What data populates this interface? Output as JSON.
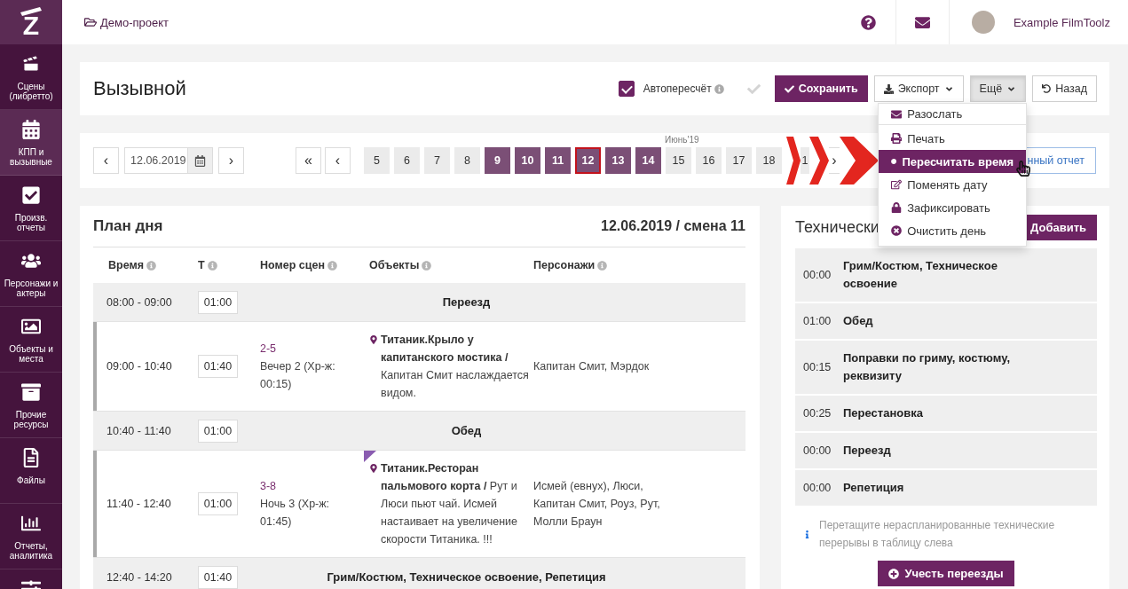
{
  "sidebar": {
    "logo": "Z",
    "items": [
      {
        "label": "Сцены (либретто)",
        "selected": false
      },
      {
        "label": "КПП и вызывные",
        "selected": true
      },
      {
        "label": "Произв. отчеты",
        "selected": false
      },
      {
        "label": "Персонажи и актеры",
        "selected": false
      },
      {
        "label": "Объекты и места",
        "selected": false
      },
      {
        "label": "Прочие ресурсы",
        "selected": false
      },
      {
        "label": "Файлы",
        "selected": false
      },
      {
        "label": "Отчеты, аналитика",
        "selected": false
      },
      {
        "selected": false
      }
    ]
  },
  "header": {
    "project": "Демо-проект",
    "user": "Example FilmToolz"
  },
  "toolbar": {
    "title": "Вызывной",
    "autorecalc": {
      "label": "Автопересчёт",
      "checked": true
    },
    "save": "Сохранить",
    "export": "Экспорт",
    "more": {
      "label": "Ещё",
      "open": true
    },
    "back": "Назад"
  },
  "menu": {
    "items": [
      {
        "label": "Разослать",
        "selected": false
      },
      {
        "label": "Печать",
        "selected": false
      },
      {
        "label": "Пересчитать время",
        "selected": true
      },
      {
        "label": "Поменять дату",
        "selected": false
      },
      {
        "label": "Зафиксировать",
        "selected": false
      },
      {
        "label": "Очистить день",
        "selected": false
      }
    ]
  },
  "date_nav": {
    "prev_day": "‹",
    "date": "12.06.2019",
    "next_day": "›",
    "first_page": "«",
    "prev_page": "‹",
    "days": [
      {
        "label": "5",
        "shooting": false,
        "selected": false
      },
      {
        "label": "6",
        "shooting": false,
        "selected": false
      },
      {
        "label": "7",
        "shooting": false,
        "selected": false
      },
      {
        "label": "8",
        "shooting": false,
        "selected": false
      },
      {
        "label": "9",
        "shooting": true,
        "selected": false
      },
      {
        "label": "10",
        "shooting": true,
        "selected": false
      },
      {
        "label": "11",
        "shooting": true,
        "selected": false
      },
      {
        "label": "12",
        "shooting": true,
        "selected": true
      },
      {
        "label": "13",
        "shooting": true,
        "selected": false
      },
      {
        "label": "14",
        "shooting": true,
        "selected": false
      },
      {
        "label": "15",
        "shooting": false,
        "selected": false,
        "caption": "Июнь'19"
      },
      {
        "label": "16",
        "shooting": false,
        "selected": false
      },
      {
        "label": "17",
        "shooting": false,
        "selected": false
      },
      {
        "label": "18",
        "shooting": false,
        "selected": false
      },
      {
        "label": "1",
        "shooting": false,
        "selected": false
      }
    ],
    "next_page": "›",
    "report": "нный отчет"
  },
  "plan": {
    "title": "План дня",
    "shift": "12.06.2019 / смена 11",
    "columns": [
      "Время",
      "Т",
      "Номер сцен",
      "Объекты",
      "Персонажи"
    ],
    "rows": [
      {
        "kind": "break",
        "time": "08:00 - 09:00",
        "duration": "01:00",
        "title": "Переезд"
      },
      {
        "kind": "scene",
        "time": "09:00 - 10:40",
        "duration": "01:40",
        "scenes": "2-5",
        "scene_info": "Вечер 2 (Хр-ж: 00:15)",
        "objects": "**Титаник.Крыло у капитанского мостика /** Капитан Смит наслаждается видом.",
        "characters": "Капитан Смит, Мэрдок",
        "flagged": false
      },
      {
        "kind": "break",
        "time": "10:40 - 11:40",
        "duration": "01:00",
        "title": "Обед"
      },
      {
        "kind": "scene",
        "time": "11:40 - 12:40",
        "duration": "01:00",
        "scenes": "3-8",
        "scene_info": "Ночь 3 (Хр-ж: 01:45)",
        "objects": "**Титаник.Ресторан пальмового корта /** Рут и Люси пьют чай. Исмей настаивает на увеличение скорости Титаника. !!!",
        "characters": "Исмей (евнух), Люси, Капитан Смит, Роуз, Рут, Молли Браун",
        "flagged": true
      },
      {
        "kind": "break",
        "time": "12:40 - 14:20",
        "duration": "01:40",
        "title": "Грим/Костюм, Техническое освоение, Репетиция"
      }
    ]
  },
  "breaks": {
    "title": "Технически",
    "add": "Добавить",
    "items": [
      {
        "time": "00:00",
        "title": "Грим/Костюм, Техническое освоение"
      },
      {
        "time": "01:00",
        "title": "Обед"
      },
      {
        "time": "00:15",
        "title": "Поправки по гриму, костюму, реквизиту"
      },
      {
        "time": "00:25",
        "title": "Перестановка"
      },
      {
        "time": "00:00",
        "title": "Переезд"
      },
      {
        "time": "00:00",
        "title": "Репетиция"
      }
    ],
    "hint": "Перетащите нераспланированные технические перерывы в таблицу слева",
    "action": "Учесть переезды"
  }
}
